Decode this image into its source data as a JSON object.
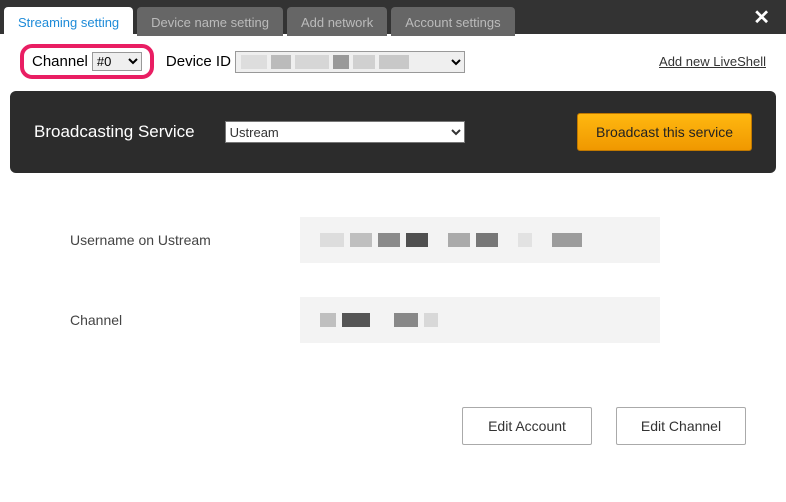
{
  "tabs": {
    "streaming": "Streaming setting",
    "device_name": "Device name setting",
    "add_network": "Add network",
    "account": "Account settings"
  },
  "toprow": {
    "channel_label": "Channel",
    "channel_value": "#0",
    "device_id_label": "Device ID",
    "add_link": "Add new LiveShell"
  },
  "service_bar": {
    "label": "Broadcasting Service",
    "selected": "Ustream",
    "broadcast_button": "Broadcast this service"
  },
  "form": {
    "username_label": "Username on Ustream",
    "channel_label": "Channel"
  },
  "actions": {
    "edit_account": "Edit Account",
    "edit_channel": "Edit Channel"
  }
}
